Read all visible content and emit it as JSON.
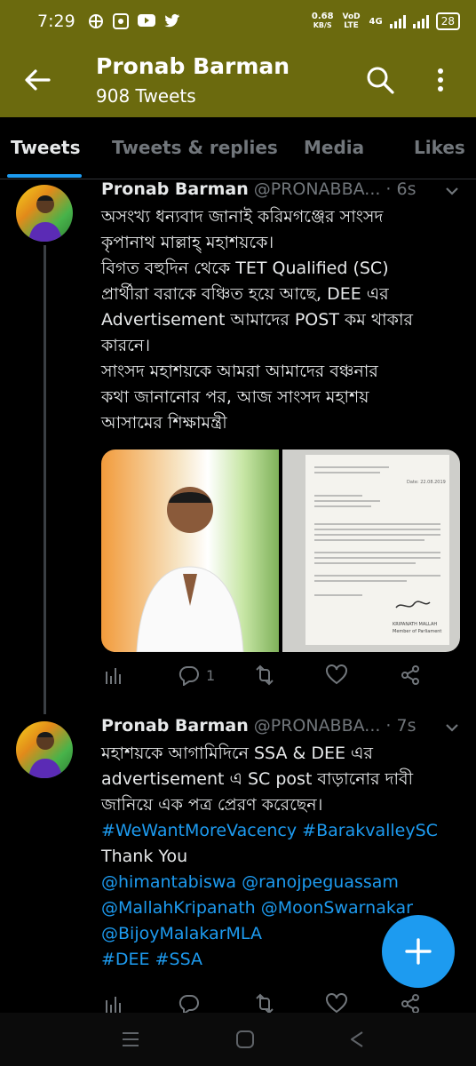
{
  "status_bar": {
    "time": "7:29",
    "net_speed": "0.68",
    "net_unit": "KB/S",
    "volte": "VoD LTE",
    "net_type": "4G",
    "battery": "28"
  },
  "header": {
    "title": "Pronab Barman",
    "subtitle": "908 Tweets"
  },
  "tabs": [
    {
      "label": "Tweets",
      "active": true
    },
    {
      "label": "Tweets & replies",
      "active": false
    },
    {
      "label": "Media",
      "active": false
    },
    {
      "label": "Likes",
      "active": false
    }
  ],
  "tweets": [
    {
      "name": "Pronab Barman",
      "handle": "@PRONABBA...",
      "time": "· 6s",
      "lines": [
        "অসংখ্য ধন্যবাদ জানাই করিমগঞ্জের সাংসদ",
        "কৃপানাথ মাল্লাহ্ মহাশয়কে।",
        "বিগত বহুদিন থেকে TET Qualified (SC)",
        "প্রার্থীরা বরাকে বঞ্চিত হয়ে আছে, DEE এর",
        "Advertisement আমাদের POST কম থাকার",
        "কারনে।",
        "সাংসদ মহাশয়কে আমরা আমাদের বঞ্চনার",
        "কথা জানানোর পর, আজ সাংসদ মহাশয়",
        "আসামের শিক্ষামন্ত্রী"
      ],
      "reply_count": "1",
      "retweet_count": "",
      "like_count": ""
    },
    {
      "name": "Pronab Barman",
      "handle": "@PRONABBA...",
      "time": "· 7s",
      "lines": [
        "মহাশয়কে আগামিদিনে  SSA & DEE এর",
        "advertisement এ  SC post বাড়ানোর দাবী",
        "জানিয়ে এক পত্র প্রেরণ করেছেন।",
        "#WeWantMoreVacency #BarakvalleySC",
        "Thank You",
        "@himantabiswa @ranojpeguassam",
        "@MallahKripanath @MoonSwarnakar",
        "@BijoyMalakarMLA",
        "#DEE #SSA"
      ],
      "link_lines": [
        3,
        5,
        6,
        7,
        8
      ]
    }
  ],
  "letter": {
    "date": "Date: 22.08.2019",
    "signature_name": "KRIPANATH MALLAH",
    "signature_title": "Member of Parliament"
  },
  "colors": {
    "header_bg": "#6b6a0e",
    "accent": "#1d9bf0",
    "muted": "#71767b",
    "background": "#000000"
  },
  "icons": {
    "back": "arrow-left-icon",
    "search": "search-icon",
    "more": "more-vertical-icon",
    "compose": "plus-icon"
  }
}
